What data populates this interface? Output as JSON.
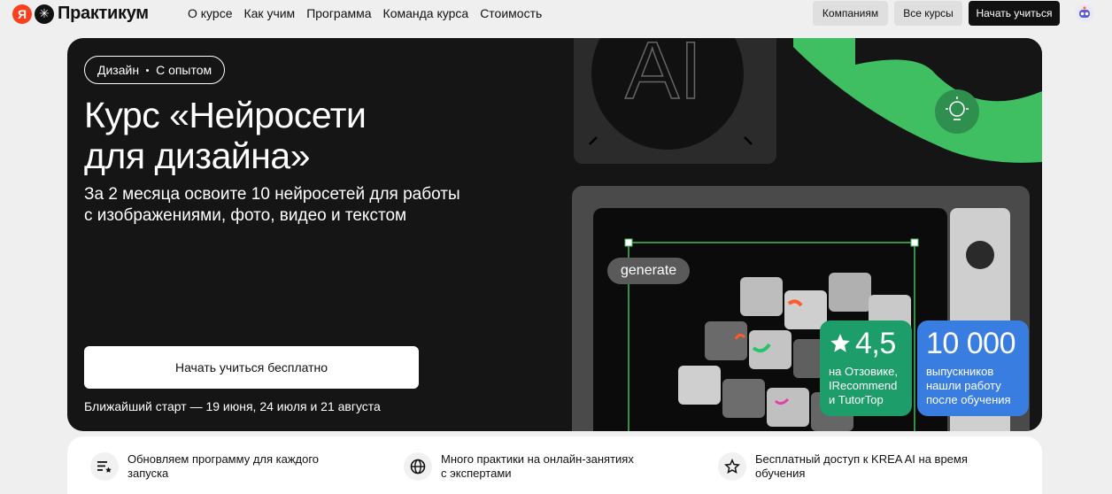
{
  "header": {
    "logo_ya": "Я",
    "logo_text": "Практикум",
    "nav": [
      "О курсе",
      "Как учим",
      "Программа",
      "Команда курса",
      "Стоимость"
    ],
    "btn_companies": "Компаниям",
    "btn_all_courses": "Все курсы",
    "btn_start": "Начать учиться"
  },
  "hero": {
    "tag_1": "Дизайн",
    "tag_2": "С опытом",
    "title_line1": "Курс «Нейросети",
    "title_line2": "для дизайна»",
    "subtitle_line1": "За 2 месяца освоите 10 нейросетей для работы",
    "subtitle_line2": "с изображениями, фото, видео и текстом",
    "cta": "Начать учиться бесплатно",
    "start_dates": "Ближайший старт — 19 июня, 24 июля и 21 августа",
    "generate_label": "generate",
    "art_letters": "AI",
    "rating": {
      "value": "4,5",
      "line1": "на Отзовике,",
      "line2": "IRecommend",
      "line3": "и TutorTop"
    },
    "graduates": {
      "value": "10 000",
      "line1": "выпускников",
      "line2": "нашли работу",
      "line3": "после обучения"
    }
  },
  "features": [
    {
      "icon": "list-star-icon",
      "line1": "Обновляем программу для каждого",
      "line2": "запуска"
    },
    {
      "icon": "globe-icon",
      "line1": "Много практики на онлайн-занятиях",
      "line2": "с экспертами"
    },
    {
      "icon": "star-outline-icon",
      "line1": "Бесплатный доступ к KREA AI на время",
      "line2": "обучения"
    }
  ],
  "colors": {
    "hero_bg": "#151515",
    "green_accent": "#3fbf62",
    "rating_badge": "#1d9d6a",
    "graduates_badge": "#3a7de0",
    "logo_red": "#fc3f1d"
  }
}
